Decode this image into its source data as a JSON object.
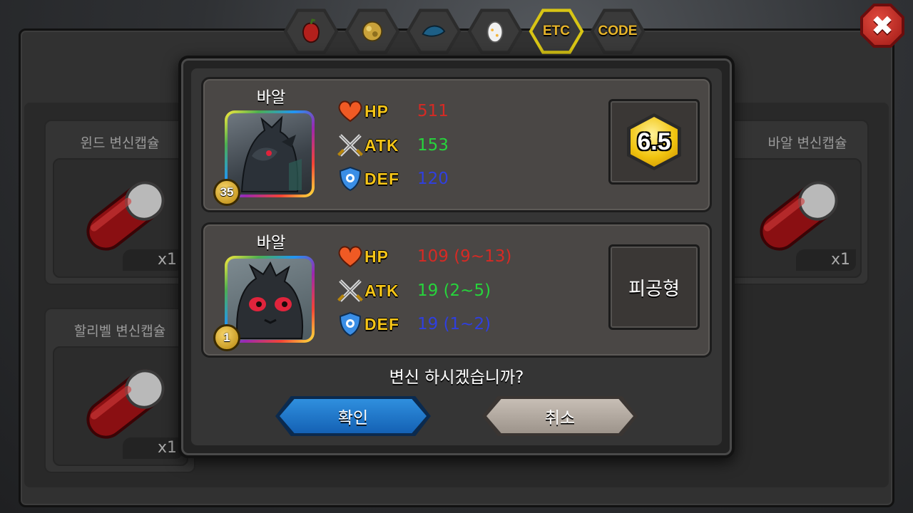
{
  "tabs": [
    {
      "icon": "fruit-icon",
      "label": ""
    },
    {
      "icon": "ore-icon",
      "label": ""
    },
    {
      "icon": "fish-icon",
      "label": ""
    },
    {
      "icon": "egg-icon",
      "label": ""
    },
    {
      "icon": "",
      "label": "ETC",
      "active": true
    },
    {
      "icon": "",
      "label": "CODE"
    }
  ],
  "close_label": "✖",
  "capsules": [
    {
      "name": "윈드 변신캡슐",
      "qty": "x1"
    },
    {
      "name": "할리벨 변신캡슐",
      "qty": "x1"
    },
    {
      "name": "바알 변신캡슐",
      "qty": "x1"
    }
  ],
  "dialog": {
    "current": {
      "name": "바알",
      "level": "35",
      "hp_label": "HP",
      "atk_label": "ATK",
      "def_label": "DEF",
      "hp": "511",
      "atk": "153",
      "def": "120",
      "grade": "6.5"
    },
    "result": {
      "name": "바알",
      "level": "1",
      "hp_label": "HP",
      "atk_label": "ATK",
      "def_label": "DEF",
      "hp": "109 (9~13)",
      "atk": "19 (2~5)",
      "def": "19 (1~2)",
      "type": "피공형"
    },
    "question": "변신 하시겠습니까?",
    "confirm_label": "확인",
    "cancel_label": "취소"
  },
  "colors": {
    "hp": "#d62a24",
    "atk": "#27d43c",
    "def": "#2f3fe0",
    "stat_label": "#f5c518",
    "confirm": "#1e77cc",
    "cancel": "#b3aaa1"
  }
}
